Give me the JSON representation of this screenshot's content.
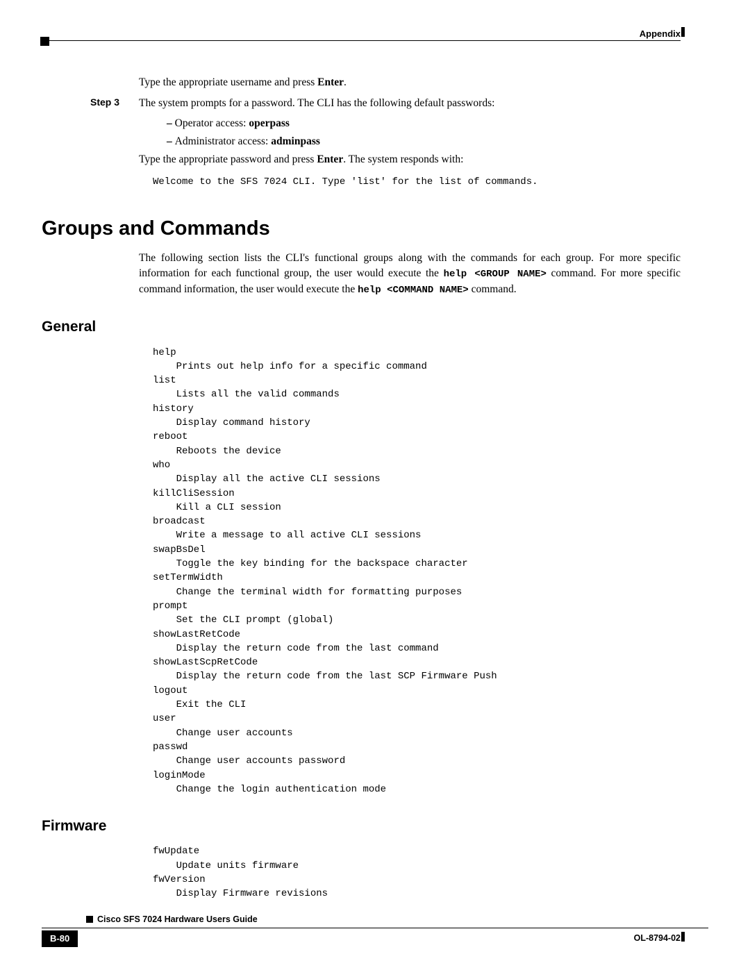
{
  "header": {
    "appendix": "Appendix"
  },
  "step2": {
    "line1_a": "Type the appropriate username and press ",
    "line1_b": "Enter",
    "line1_c": "."
  },
  "step3": {
    "label": "Step 3",
    "intro": "The system prompts for a password. The CLI has the following default passwords:",
    "bullet1_a": "Operator access: ",
    "bullet1_b": "operpass",
    "bullet2_a": "Administrator access: ",
    "bullet2_b": "adminpass",
    "line2_a": "Type the appropriate password and press ",
    "line2_b": "Enter",
    "line2_c": ". The system responds with:",
    "code": "Welcome to the SFS 7024 CLI. Type 'list' for the list of commands."
  },
  "h2": "Groups and Commands",
  "groups_para": {
    "a": "The following section lists the CLI's functional groups along with the commands for each group. For more specific information for each functional group, the user would execute the ",
    "b": "help <GROUP NAME>",
    "c": " command. For more specific command information, the user would execute the ",
    "d": "help <COMMAND NAME>",
    "e": " command."
  },
  "general": {
    "title": "General",
    "code": "help\n    Prints out help info for a specific command\nlist\n    Lists all the valid commands\nhistory\n    Display command history\nreboot\n    Reboots the device\nwho\n    Display all the active CLI sessions\nkillCliSession\n    Kill a CLI session\nbroadcast\n    Write a message to all active CLI sessions\nswapBsDel\n    Toggle the key binding for the backspace character\nsetTermWidth\n    Change the terminal width for formatting purposes\nprompt\n    Set the CLI prompt (global)\nshowLastRetCode\n    Display the return code from the last command\nshowLastScpRetCode\n    Display the return code from the last SCP Firmware Push\nlogout\n    Exit the CLI\nuser\n    Change user accounts\npasswd\n    Change user accounts password\nloginMode\n    Change the login authentication mode"
  },
  "firmware": {
    "title": "Firmware",
    "code": "fwUpdate\n    Update units firmware\nfwVersion\n    Display Firmware revisions"
  },
  "footer": {
    "title": "Cisco SFS 7024 Hardware Users Guide",
    "page": "B-80",
    "docid": "OL-8794-02"
  }
}
